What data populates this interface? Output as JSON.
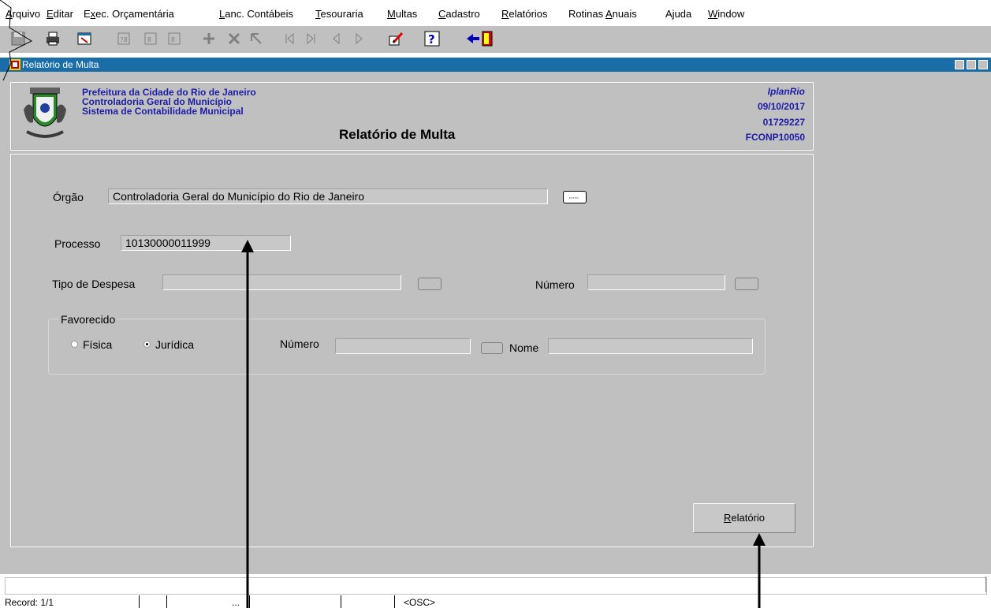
{
  "menu": [
    {
      "label": "Arquivo",
      "accel": "A"
    },
    {
      "label": "Editar",
      "accel": "E"
    },
    {
      "label": "Exec. Orçamentária",
      "accel": "x"
    },
    {
      "label": "Lanc. Contábeis",
      "accel": "L"
    },
    {
      "label": "Tesouraria",
      "accel": "T"
    },
    {
      "label": "Multas",
      "accel": "M"
    },
    {
      "label": "Cadastro",
      "accel": "C"
    },
    {
      "label": "Relatórios",
      "accel": "R"
    },
    {
      "label": "Rotinas Anuais",
      "accel": "A"
    },
    {
      "label": "Ajuda",
      "accel": "j"
    },
    {
      "label": "Window",
      "accel": "W"
    }
  ],
  "toolbar_icons": [
    "save-icon",
    "print-icon",
    "form-icon",
    "query-enter-icon",
    "query-exec-icon",
    "query-cancel-icon",
    "insert-record-icon",
    "delete-record-icon",
    "clear-record-icon",
    "first-record-icon",
    "last-record-icon",
    "previous-record-icon",
    "next-record-icon",
    "edit-icon",
    "help-icon",
    "exit-icon"
  ],
  "window": {
    "title": "Relatório de Multa"
  },
  "header": {
    "org_line1": "Prefeitura da Cidade do Rio de Janeiro",
    "org_line2": "Controladoria Geral do Município",
    "org_line3": "Sistema de Contabilidade Municipal",
    "form_title": "Relatório de Multa",
    "brand": "IplanRio",
    "date": "09/10/2017",
    "user_code": "01729227",
    "form_code": "FCONP10050"
  },
  "form": {
    "orgao_label": "Órgão",
    "orgao_value": "Controladoria Geral do Município do Rio de Janeiro",
    "processo_label": "Processo",
    "processo_value": "10130000011999",
    "tipo_despesa_label": "Tipo de Despesa",
    "tipo_despesa_value": "",
    "numero_label": "Número",
    "numero_value": "",
    "favorecido": {
      "group_label": "Favorecido",
      "fisica_label": "Física",
      "juridica_label": "Jurídica",
      "selected": "Jurídica",
      "numero_label": "Número",
      "numero_value": "",
      "nome_label": "Nome",
      "nome_value": ""
    },
    "report_button": "Relatório",
    "report_button_accel": "R"
  },
  "status": {
    "record": "Record: 1/1",
    "ellipsis": "...",
    "mode": "<OSC>"
  },
  "colors": {
    "titlebar": "#1a6ea8",
    "header_text": "#1c1ca8",
    "panel": "#c0c0c0"
  }
}
